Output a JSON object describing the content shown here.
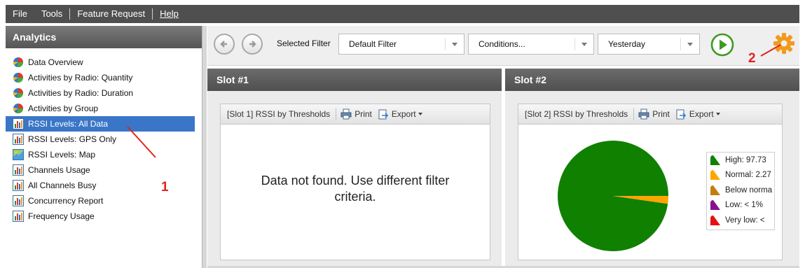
{
  "menu": {
    "file": "File",
    "tools": "Tools",
    "feature_request": "Feature Request",
    "help": "Help"
  },
  "sidebar": {
    "title": "Analytics",
    "items": [
      {
        "label": "Data Overview",
        "icon": "pie-chart-icon"
      },
      {
        "label": "Activities by Radio: Quantity",
        "icon": "pie-chart-icon"
      },
      {
        "label": "Activities by Radio: Duration",
        "icon": "pie-chart-icon"
      },
      {
        "label": "Activities by Group",
        "icon": "pie-chart-icon"
      },
      {
        "label": "RSSI Levels: All Data",
        "icon": "bar-chart-icon",
        "selected": true
      },
      {
        "label": "RSSI Levels: GPS Only",
        "icon": "bar-chart-icon"
      },
      {
        "label": "RSSI Levels: Map",
        "icon": "map-icon"
      },
      {
        "label": "Channels Usage",
        "icon": "bar-chart-icon"
      },
      {
        "label": "All Channels Busy",
        "icon": "bar-chart-icon"
      },
      {
        "label": "Concurrency Report",
        "icon": "bar-chart-icon"
      },
      {
        "label": "Frequency Usage",
        "icon": "bar-chart-icon"
      }
    ]
  },
  "toolbar": {
    "selected_filter_label": "Selected Filter",
    "filter_value": "Default Filter",
    "conditions_value": "Conditions...",
    "date_value": "Yesterday"
  },
  "annotations": {
    "one": "1",
    "two": "2"
  },
  "slot1": {
    "title": "Slot #1",
    "panel_title": "[Slot 1] RSSI by Thresholds",
    "print": "Print",
    "export": "Export",
    "message_line1": "Data not found. Use different filter",
    "message_line2": "criteria."
  },
  "slot2": {
    "title": "Slot #2",
    "panel_title": "[Slot 2] RSSI by Thresholds",
    "print": "Print",
    "export": "Export"
  },
  "chart_data": {
    "type": "pie",
    "slices": [
      {
        "name": "High",
        "value": 97.73,
        "color": "#108000"
      },
      {
        "name": "Normal",
        "value": 2.27,
        "color": "#ffa500"
      },
      {
        "name": "Below normal",
        "value": 0,
        "color": "#c08010"
      },
      {
        "name": "Low",
        "value": 0,
        "color": "#8a1090"
      },
      {
        "name": "Very low",
        "value": 0,
        "color": "#e81010"
      }
    ],
    "legend": [
      {
        "text": "High: 97.73",
        "color": "#108000"
      },
      {
        "text": "Normal: 2.27",
        "color": "#ffa500"
      },
      {
        "text": "Below norma",
        "color": "#c08010"
      },
      {
        "text": "Low: < 1%",
        "color": "#8a1090"
      },
      {
        "text": "Very low: <",
        "color": "#e81010"
      }
    ],
    "legend_position": "right"
  }
}
